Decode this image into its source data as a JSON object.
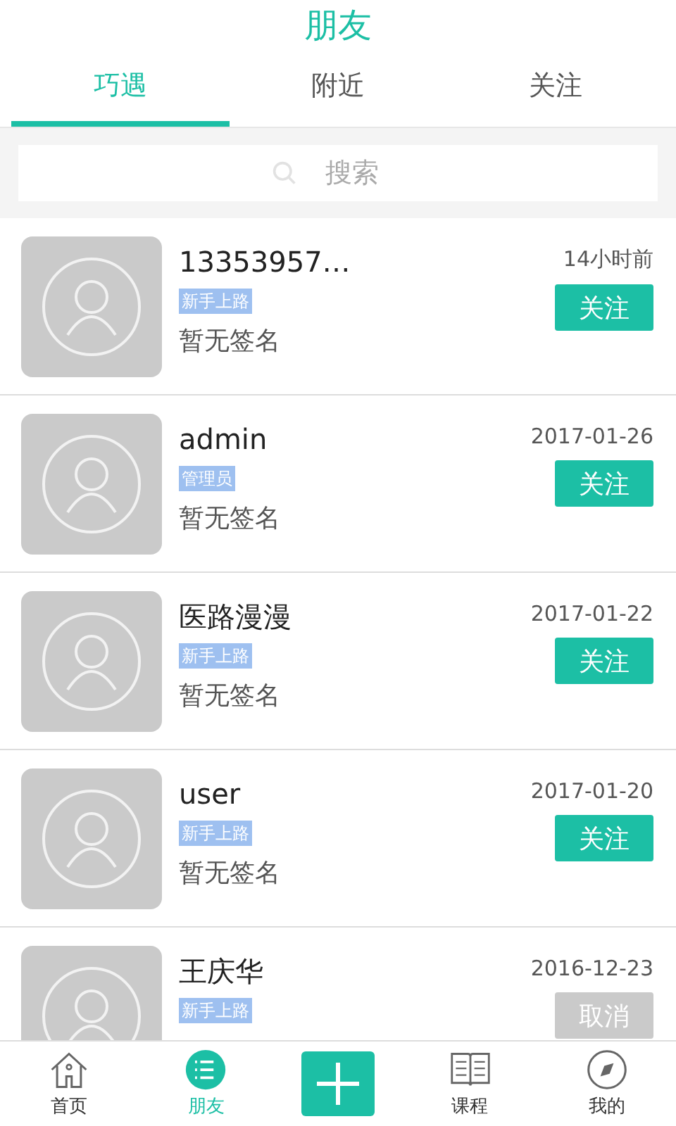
{
  "header": {
    "title": "朋友"
  },
  "tabs": [
    {
      "label": "巧遇",
      "selected": true
    },
    {
      "label": "附近",
      "selected": false
    },
    {
      "label": "关注",
      "selected": false
    }
  ],
  "search": {
    "placeholder": "搜索"
  },
  "users": [
    {
      "name": "13353957…",
      "badge": "新手上路",
      "signature": "暂无签名",
      "time": "14小时前",
      "action": "关注",
      "following": false
    },
    {
      "name": "admin",
      "badge": "管理员",
      "signature": "暂无签名",
      "time": "2017-01-26",
      "action": "关注",
      "following": false
    },
    {
      "name": "医路漫漫",
      "badge": "新手上路",
      "signature": "暂无签名",
      "time": "2017-01-22",
      "action": "关注",
      "following": false
    },
    {
      "name": "user",
      "badge": "新手上路",
      "signature": "暂无签名",
      "time": "2017-01-20",
      "action": "关注",
      "following": false
    },
    {
      "name": "王庆华",
      "badge": "新手上路",
      "time": "2016-12-23",
      "action": "取消",
      "following": true
    }
  ],
  "bottom_nav": [
    {
      "kind": "home",
      "label": "首页",
      "selected": false
    },
    {
      "kind": "friends",
      "label": "朋友",
      "selected": true
    },
    {
      "kind": "add"
    },
    {
      "kind": "courses",
      "label": "课程",
      "selected": false
    },
    {
      "kind": "mine",
      "label": "我的",
      "selected": false
    }
  ]
}
